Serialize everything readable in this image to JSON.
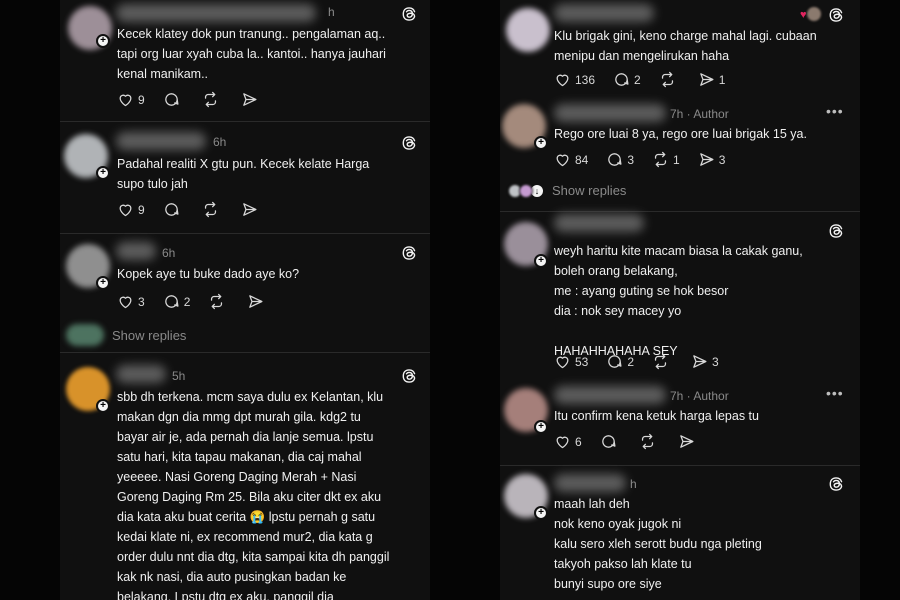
{
  "left": {
    "posts": [
      {
        "time": "h",
        "text": "Kecek klatey dok pun tranung.. pengalaman aq..\ntapi org luar xyah cuba la.. kantoi.. hanya jauhari\nkenal manikam..",
        "likes": "9",
        "replies": "",
        "reposts": "",
        "shares": ""
      },
      {
        "time": "6h",
        "text": "Padahal realiti X gtu pun. Kecek kelate Harga\nsupo tulo jah",
        "likes": "9",
        "replies": "",
        "reposts": "",
        "shares": ""
      },
      {
        "time": "6h",
        "text": "Kopek aye tu buke dado aye ko?",
        "likes": "3",
        "replies": "2",
        "reposts": "",
        "shares": "",
        "show_replies": "Show replies"
      },
      {
        "time": "5h",
        "text": "sbb dh terkena. mcm saya dulu ex Kelantan, klu\nmakan dgn dia mmg dpt murah gila. kdg2 tu\nbayar air je, ada pernah dia lanje semua. lpstu\nsatu hari, kita tapau makanan, dia caj mahal\nyeeeee. Nasi Goreng Daging Merah + Nasi\nGoreng Daging Rm 25. Bila aku citer dkt ex aku\ndia kata aku buat cerita 😭 lpstu pernah g satu\nkedai klate ni, ex recommend mur2, dia kata g\norder dulu nnt dia dtg, kita sampai kita dh panggil\nkak nk nasi, dia auto pusingkan badan ke\nbelakang. Lpstu dtg ex aku, panggil dia"
      }
    ]
  },
  "right": {
    "posts": [
      {
        "time": "",
        "text": "Klu brigak gini, keno charge mahal lagi.  cubaan\nmenipu dan mengelirukan haha",
        "likes": "136",
        "replies": "2",
        "reposts": "",
        "shares": "1"
      },
      {
        "time": "7h · Author",
        "text": "Rego ore luai 8 ya, rego ore luai brigak 15 ya.",
        "likes": "84",
        "replies": "3",
        "reposts": "1",
        "shares": "3",
        "show_replies": "Show replies"
      },
      {
        "time": "",
        "text": "weyh haritu kite macam biasa la cakak ganu,\nboleh orang belakang,\nme : ayang guting se hok besor\ndia : nok sey macey yo\n\nHAHAHHAHAHA SEY",
        "likes": "53",
        "replies": "2",
        "reposts": "",
        "shares": "3"
      },
      {
        "time": "7h · Author",
        "text": "Itu confirm kena ketuk harga lepas tu",
        "likes": "6",
        "replies": "",
        "reposts": "",
        "shares": ""
      },
      {
        "time": "h",
        "text": "maah lah deh\nnok keno oyak jugok ni\nkalu sero xleh serott budu nga pleting\ntakyoh pakso lah klate tu\nbunyi supo ore siye"
      }
    ]
  },
  "icons": [
    "heart-icon",
    "comment-icon",
    "repost-icon",
    "share-icon",
    "threads-icon",
    "more-icon"
  ],
  "colors": {
    "background": "#101010",
    "text": "#f0f0f0",
    "muted": "#8a8a8a",
    "divider": "#2a2a2a",
    "like_red": "#e0245e"
  }
}
